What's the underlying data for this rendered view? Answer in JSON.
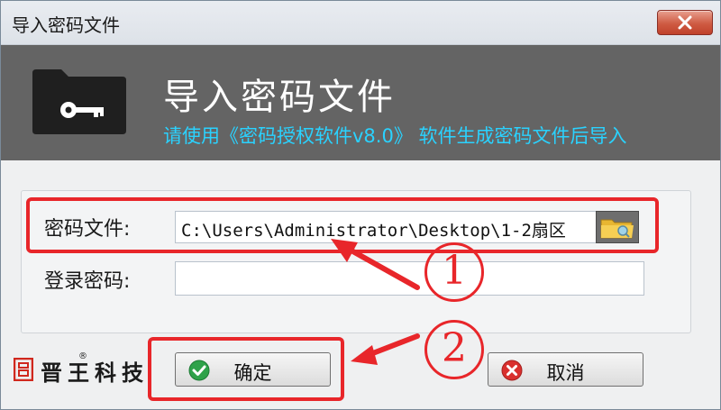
{
  "window": {
    "title": "导入密码文件"
  },
  "banner": {
    "title": "导入密码文件",
    "subtitle": "请使用《密码授权软件v8.0》 软件生成密码文件后导入"
  },
  "form": {
    "password_file_label": "密码文件:",
    "password_file_value": "C:\\Users\\Administrator\\Desktop\\1-2扇区",
    "login_password_label": "登录密码:",
    "login_password_value": ""
  },
  "buttons": {
    "confirm_label": "确定",
    "cancel_label": "取消"
  },
  "annotations": {
    "step1": "1",
    "step2": "2"
  },
  "brand": {
    "text": "晋王科技",
    "registered": "®"
  },
  "icons": {
    "folder_key": "folder-key-icon",
    "browse": "folder-browse-icon",
    "confirm": "check-circle-icon",
    "cancel": "x-circle-icon",
    "close": "close-icon"
  },
  "colors": {
    "banner_bg": "#646464",
    "subtitle": "#2ad2ff",
    "highlight": "#e8262a",
    "close_button": "#cf5b43"
  }
}
